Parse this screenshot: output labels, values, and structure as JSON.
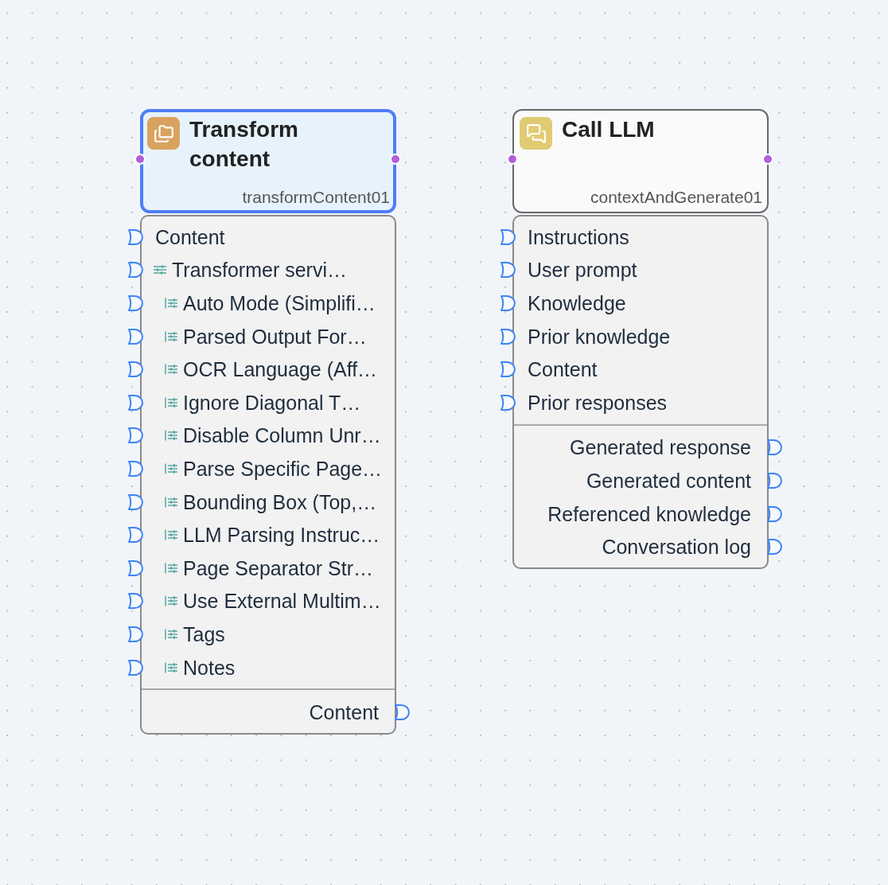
{
  "canvas": {
    "nodes": [
      {
        "kind": "transform",
        "color": "#d9a35f",
        "selected": true,
        "title": "Transform content",
        "node_id": "transformContent01",
        "inputs": [
          {
            "label": "Content",
            "kind": "data"
          },
          {
            "label": "Transformer servi…",
            "kind": "setting",
            "children": [
              {
                "label": "Auto Mode (Simplifi…",
                "kind": "setting"
              },
              {
                "label": "Parsed Output For…",
                "kind": "setting"
              },
              {
                "label": "OCR Language (Aff…",
                "kind": "setting"
              },
              {
                "label": "Ignore Diagonal T…",
                "kind": "setting"
              },
              {
                "label": "Disable Column Unr…",
                "kind": "setting"
              },
              {
                "label": "Parse Specific Page…",
                "kind": "setting"
              },
              {
                "label": "Bounding Box (Top,…",
                "kind": "setting"
              },
              {
                "label": "LLM Parsing Instruc…",
                "kind": "setting"
              },
              {
                "label": "Page Separator Str…",
                "kind": "setting"
              },
              {
                "label": "Use External Multim…",
                "kind": "setting"
              },
              {
                "label": "Tags",
                "kind": "setting"
              },
              {
                "label": "Notes",
                "kind": "setting"
              }
            ]
          }
        ],
        "outputs": [
          {
            "label": "Content"
          }
        ]
      },
      {
        "kind": "llm",
        "color": "#e1cb72",
        "selected": false,
        "title": "Call LLM",
        "node_id": "contextAndGenerate01",
        "inputs": [
          {
            "label": "Instructions",
            "kind": "data"
          },
          {
            "label": "User prompt",
            "kind": "data"
          },
          {
            "label": "Knowledge",
            "kind": "data"
          },
          {
            "label": "Prior knowledge",
            "kind": "data"
          },
          {
            "label": "Content",
            "kind": "data"
          },
          {
            "label": "Prior responses",
            "kind": "data"
          }
        ],
        "outputs": [
          {
            "label": "Generated response"
          },
          {
            "label": "Generated content"
          },
          {
            "label": "Referenced knowledge"
          },
          {
            "label": "Conversation log"
          }
        ]
      }
    ]
  }
}
